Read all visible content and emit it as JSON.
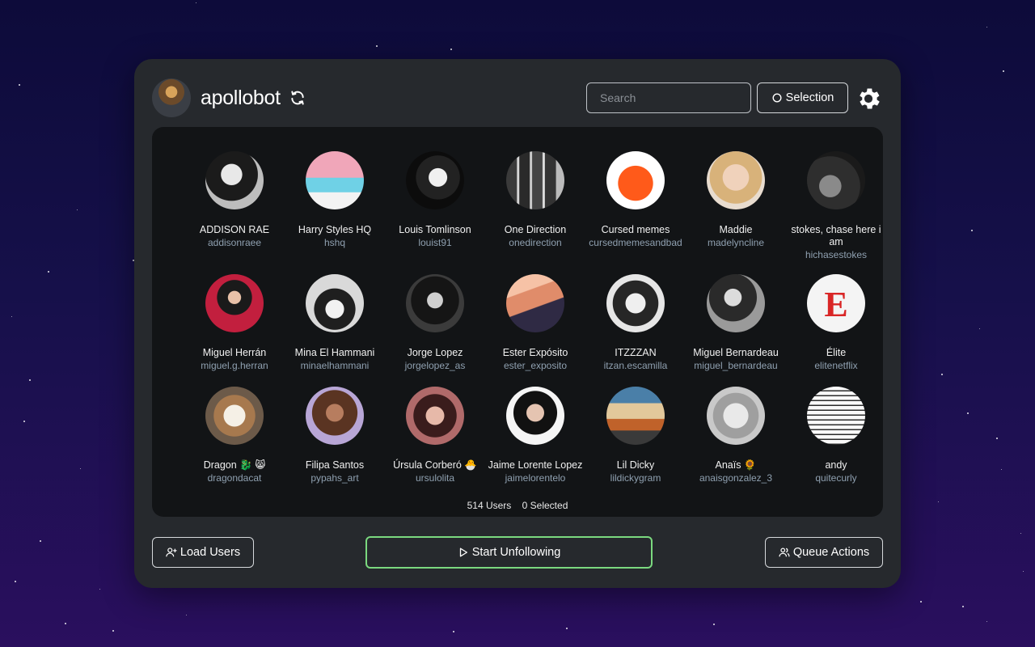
{
  "header": {
    "username": "apollobot",
    "search_placeholder": "Search",
    "selection_label": "Selection"
  },
  "users": [
    {
      "name": "ADDISON RAE",
      "handle": "addisonraee",
      "avatar": "woman-dark-hair-bw"
    },
    {
      "name": "Harry Styles HQ",
      "handle": "hshq",
      "avatar": "pink-pool-stage"
    },
    {
      "name": "Louis Tomlinson",
      "handle": "louist91",
      "avatar": "man-bw-portrait"
    },
    {
      "name": "One Direction",
      "handle": "onedirection",
      "avatar": "band-group-photo"
    },
    {
      "name": "Cursed memes",
      "handle": "cursedmemesandbad",
      "avatar": "orange-cartoon"
    },
    {
      "name": "Maddie",
      "handle": "madelyncline",
      "avatar": "blonde-woman"
    },
    {
      "name": "stokes, chase here i am",
      "handle": "hichasestokes",
      "avatar": "man-dark-bw"
    },
    {
      "name": "Miguel Herrán",
      "handle": "miguel.g.herran",
      "avatar": "man-award-red"
    },
    {
      "name": "Mina El Hammani",
      "handle": "minaelhammani",
      "avatar": "woman-curly-bw"
    },
    {
      "name": "Jorge Lopez",
      "handle": "jorgelopez_as",
      "avatar": "man-curly-bw"
    },
    {
      "name": "Ester Expósito",
      "handle": "ester_exposito",
      "avatar": "woman-sunset"
    },
    {
      "name": "ITZZZAN",
      "handle": "itzan.escamilla",
      "avatar": "man-bw-close"
    },
    {
      "name": "Miguel Bernardeau",
      "handle": "miguel_bernardeau",
      "avatar": "man-bw-pose"
    },
    {
      "name": "Élite",
      "handle": "elitenetflix",
      "avatar": "elite-logo"
    },
    {
      "name": "Dragon 🐉 😸",
      "handle": "dragondacat",
      "avatar": "cat-photo"
    },
    {
      "name": "Filipa Santos",
      "handle": "pypahs_art",
      "avatar": "illustrated-woman"
    },
    {
      "name": "Úrsula Corberó 🐣",
      "handle": "ursulolita",
      "avatar": "woman-short-hair"
    },
    {
      "name": "Jaime Lorente Lopez",
      "handle": "jaimelorentelo",
      "avatar": "man-smiling"
    },
    {
      "name": "Lil Dicky",
      "handle": "lildickygram",
      "avatar": "man-dave-sign"
    },
    {
      "name": "Anaïs 🌻",
      "handle": "anaisgonzalez_3",
      "avatar": "pencil-sketch"
    },
    {
      "name": "andy",
      "handle": "quitecurly",
      "avatar": "line-drawing"
    }
  ],
  "elite_logo_letter": "E",
  "stats": {
    "users": "514 Users",
    "selected": "0 Selected"
  },
  "footer": {
    "load_label": "Load Users",
    "start_label": "Start Unfollowing",
    "queue_label": "Queue Actions"
  },
  "colors": {
    "panel": "#26292d",
    "grid": "#121416",
    "accent_green": "#7bd97f",
    "handle": "#8fa0b0"
  }
}
